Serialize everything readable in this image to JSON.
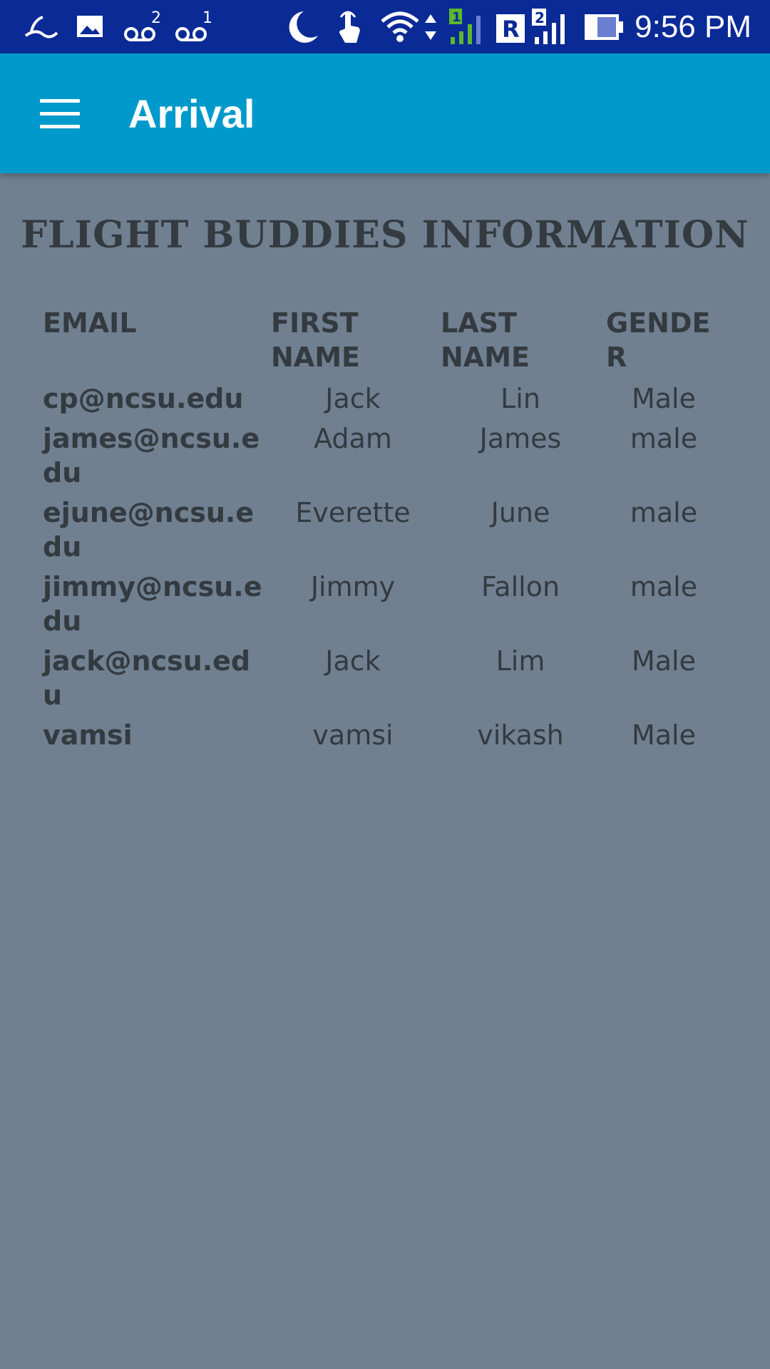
{
  "status_bar": {
    "time": "9:56 PM",
    "left_icons": [
      "yahoo-weather-icon",
      "image-icon",
      "voicemail-2-icon",
      "voicemail-1-icon"
    ],
    "right_icons": [
      "do-not-disturb-moon-icon",
      "touch-hand-icon",
      "wifi-icon",
      "data-arrows-icon",
      "signal-sim1-icon",
      "roaming-r-icon",
      "signal-sim2-icon",
      "battery-icon"
    ]
  },
  "app_bar": {
    "title": "Arrival",
    "menu_icon": "hamburger-menu-icon",
    "background": "#0099cc"
  },
  "page": {
    "heading": "FLIGHT BUDDIES INFORMATION",
    "background": "#708090"
  },
  "table": {
    "headers": [
      "EMAIL",
      "FIRST NAME",
      "LAST NAME",
      "GENDER"
    ],
    "rows": [
      {
        "email": "cp@ncsu.edu",
        "first_name": "Jack",
        "last_name": "Lin",
        "gender": "Male"
      },
      {
        "email": "james@ncsu.edu",
        "first_name": "Adam",
        "last_name": "James",
        "gender": "male"
      },
      {
        "email": "ejune@ncsu.edu",
        "first_name": "Everette",
        "last_name": "June",
        "gender": "male"
      },
      {
        "email": "jimmy@ncsu.edu",
        "first_name": "Jimmy",
        "last_name": "Fallon",
        "gender": "male"
      },
      {
        "email": "jack@ncsu.edu",
        "first_name": "Jack",
        "last_name": "Lim",
        "gender": "Male"
      },
      {
        "email": "vamsi",
        "first_name": "vamsi",
        "last_name": "vikash",
        "gender": "Male"
      }
    ]
  }
}
